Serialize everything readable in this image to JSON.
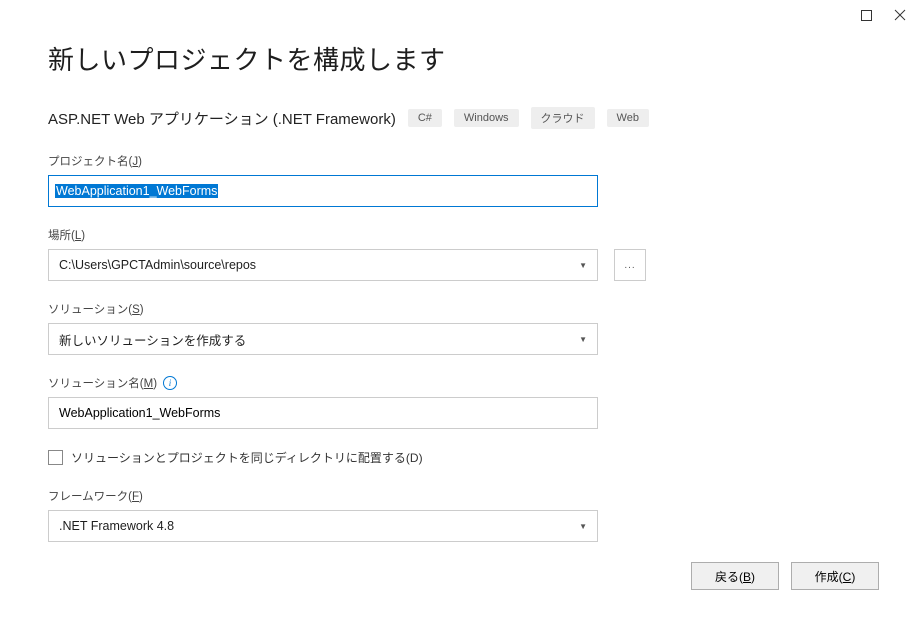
{
  "window": {
    "title": "新しいプロジェクトを構成します"
  },
  "project_template": {
    "name": "ASP.NET Web アプリケーション (.NET Framework)",
    "tags": [
      "C#",
      "Windows",
      "クラウド",
      "Web"
    ]
  },
  "fields": {
    "project_name": {
      "label_prefix": "プロジェクト名(",
      "label_key": "J",
      "label_suffix": ")",
      "value": "WebApplication1_WebForms"
    },
    "location": {
      "label_prefix": "場所(",
      "label_key": "L",
      "label_suffix": ")",
      "value": "C:\\Users\\GPCTAdmin\\source\\repos",
      "browse": "..."
    },
    "solution": {
      "label_prefix": "ソリューション(",
      "label_key": "S",
      "label_suffix": ")",
      "value": "新しいソリューションを作成する"
    },
    "solution_name": {
      "label_prefix": "ソリューション名(",
      "label_key": "M",
      "label_suffix": ")",
      "info": "i",
      "value": "WebApplication1_WebForms"
    },
    "same_dir": {
      "label_prefix": "ソリューションとプロジェクトを同じディレクトリに配置する(",
      "label_key": "D",
      "label_suffix": ")",
      "checked": false
    },
    "framework": {
      "label_prefix": "フレームワーク(",
      "label_key": "F",
      "label_suffix": ")",
      "value": ".NET Framework 4.8"
    }
  },
  "buttons": {
    "back_prefix": "戻る(",
    "back_key": "B",
    "back_suffix": ")",
    "create_prefix": "作成(",
    "create_key": "C",
    "create_suffix": ")"
  }
}
